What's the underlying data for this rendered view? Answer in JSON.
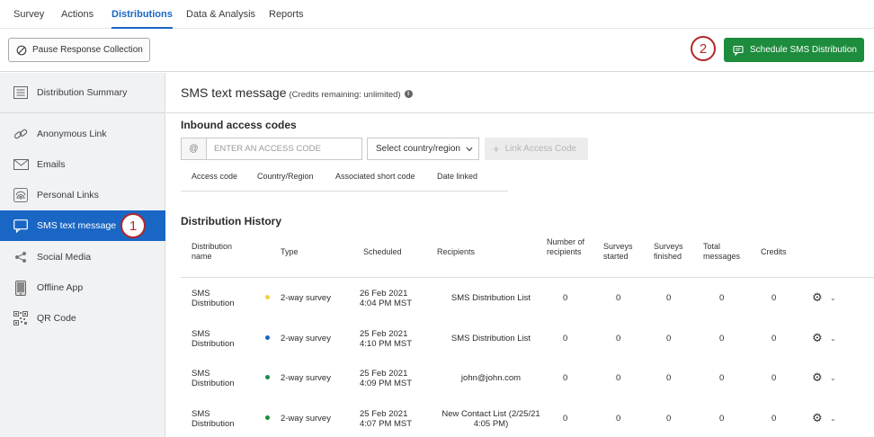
{
  "nav": {
    "tabs": [
      {
        "label": "Survey",
        "active": false
      },
      {
        "label": "Actions",
        "active": false
      },
      {
        "label": "Distributions",
        "active": true
      },
      {
        "label": "Data & Analysis",
        "active": false
      },
      {
        "label": "Reports",
        "active": false
      }
    ]
  },
  "toolbar": {
    "pause_label": "Pause Response Collection",
    "schedule_label": "Schedule SMS Distribution",
    "step2": "2"
  },
  "sidebar": {
    "items": [
      {
        "label": "Distribution Summary",
        "icon": "list-icon"
      },
      {
        "label": "Anonymous Link",
        "icon": "link-icon"
      },
      {
        "label": "Emails",
        "icon": "envelope-icon"
      },
      {
        "label": "Personal Links",
        "icon": "fingerprint-icon"
      },
      {
        "label": "SMS text message",
        "icon": "chat-icon",
        "active": true
      },
      {
        "label": "Social Media",
        "icon": "share-icon"
      },
      {
        "label": "Offline App",
        "icon": "tablet-icon"
      },
      {
        "label": "QR Code",
        "icon": "qr-icon"
      }
    ],
    "step1": "1"
  },
  "main": {
    "title": "SMS text message",
    "credits": "(Credits remaining: unlimited)",
    "inbound_heading": "Inbound access codes",
    "code_placeholder": "ENTER AN ACCESS CODE",
    "at_symbol": "@",
    "country_select": "Select country/region",
    "link_button": "Link Access Code",
    "code_columns": [
      "Access code",
      "Country/Region",
      "Associated short code",
      "Date linked"
    ],
    "history_heading": "Distribution History",
    "history_columns": {
      "name": "Distribution name",
      "type": "Type",
      "scheduled": "Scheduled",
      "recipients": "Recipients",
      "num_recipients": "Number of recipients",
      "started": "Surveys started",
      "finished": "Surveys finished",
      "messages": "Total messages",
      "credits": "Credits"
    },
    "rows": [
      {
        "name": "SMS Distribution",
        "dot_color": "#f2d23a",
        "type": "2-way survey",
        "date": "26 Feb 2021",
        "time": "4:04 PM MST",
        "recipients": "SMS Distribution List",
        "num": "0",
        "started": "0",
        "finished": "0",
        "messages": "0",
        "credits": "0"
      },
      {
        "name": "SMS Distribution",
        "dot_color": "#1a66c4",
        "type": "2-way survey",
        "date": "25 Feb 2021",
        "time": "4:10 PM MST",
        "recipients": "SMS Distribution List",
        "num": "0",
        "started": "0",
        "finished": "0",
        "messages": "0",
        "credits": "0"
      },
      {
        "name": "SMS Distribution",
        "dot_color": "#1d8c3d",
        "type": "2-way survey",
        "date": "25 Feb 2021",
        "time": "4:09 PM MST",
        "recipients": "john@john.com",
        "num": "0",
        "started": "0",
        "finished": "0",
        "messages": "0",
        "credits": "0"
      },
      {
        "name": "SMS Distribution",
        "dot_color": "#1d8c3d",
        "type": "2-way survey",
        "date": "25 Feb 2021",
        "time": "4:07 PM MST",
        "recipients": "New Contact List (2/25/21 4:05 PM)",
        "num": "0",
        "started": "0",
        "finished": "0",
        "messages": "0",
        "credits": "0"
      }
    ]
  }
}
